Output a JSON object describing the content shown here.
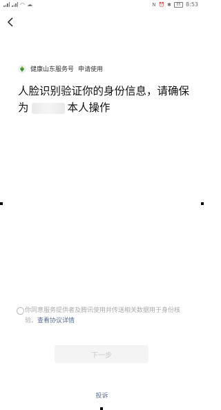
{
  "status_bar": {
    "time": "8:53",
    "network": "4G",
    "battery": "65"
  },
  "header": {
    "back_icon": "chevron-left-icon"
  },
  "app": {
    "name": "健康山东服务号",
    "request": "申请使用",
    "logo_icon": "health-logo-icon",
    "logo_color": "#3a8f3a"
  },
  "headline": {
    "line_before_name": "人脸识别验证你的身份信息，请确保为",
    "line_after_name": "本人操作"
  },
  "agreement": {
    "text": "你同意服务提供者及腾讯使用并传送相关数据用于身份核验。",
    "link": "查看协议详情"
  },
  "next_button": {
    "label": "下一步"
  },
  "complain_link": {
    "label": "投诉"
  },
  "colors": {
    "link": "#576b95",
    "disabled_text": "#c8c8c8",
    "disabled_bg": "#f4f4f4"
  }
}
